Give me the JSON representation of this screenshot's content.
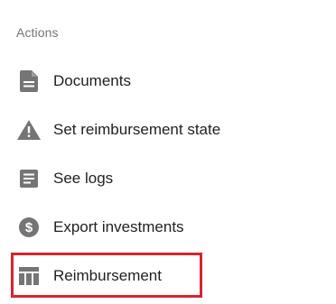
{
  "section": {
    "title": "Actions"
  },
  "menu": {
    "items": [
      {
        "label": "Documents",
        "icon": "document-icon"
      },
      {
        "label": "Set reimbursement state",
        "icon": "warning-icon"
      },
      {
        "label": "See logs",
        "icon": "logs-icon"
      },
      {
        "label": "Export investments",
        "icon": "dollar-icon"
      },
      {
        "label": "Reimbursement",
        "icon": "table-icon",
        "highlighted": true
      }
    ]
  },
  "colors": {
    "icon": "#757575",
    "text": "#212121",
    "section_title": "#757575",
    "highlight_border": "#d8232f"
  }
}
